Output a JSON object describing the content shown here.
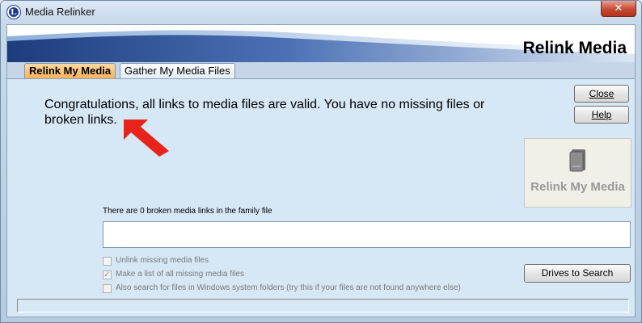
{
  "window": {
    "title": "Media Relinker",
    "app_icon_letter": "L",
    "close_glyph": "✕"
  },
  "banner": {
    "title": "Relink Media"
  },
  "tabs": [
    {
      "label": "Relink My Media",
      "active": true
    },
    {
      "label": "Gather My Media Files",
      "active": false
    }
  ],
  "main": {
    "message": "Congratulations, all links to media files are valid.  You have no missing files or broken links.",
    "broken_links_label": "There are 0 broken media links in the family file",
    "broken_links_value": ""
  },
  "buttons": {
    "close_label": "Close",
    "help_label": "Help",
    "relink_label": "Relink My Media",
    "drives_label": "Drives to Search"
  },
  "options": [
    {
      "label": "Unlink missing media files",
      "checked": false,
      "enabled": false
    },
    {
      "label": "Make a list of all missing media files",
      "checked": true,
      "enabled": false
    },
    {
      "label": "Also search for files in Windows system folders (try this if your files are not found anywhere else)",
      "checked": false,
      "enabled": false
    }
  ],
  "icons": {
    "arrow": "red-arrow-icon",
    "relink": "document-icon"
  },
  "colors": {
    "active_tab": "#f6b25a",
    "arrow": "#e8231c",
    "banner_swoosh": "#2b4d8c"
  },
  "status": ""
}
